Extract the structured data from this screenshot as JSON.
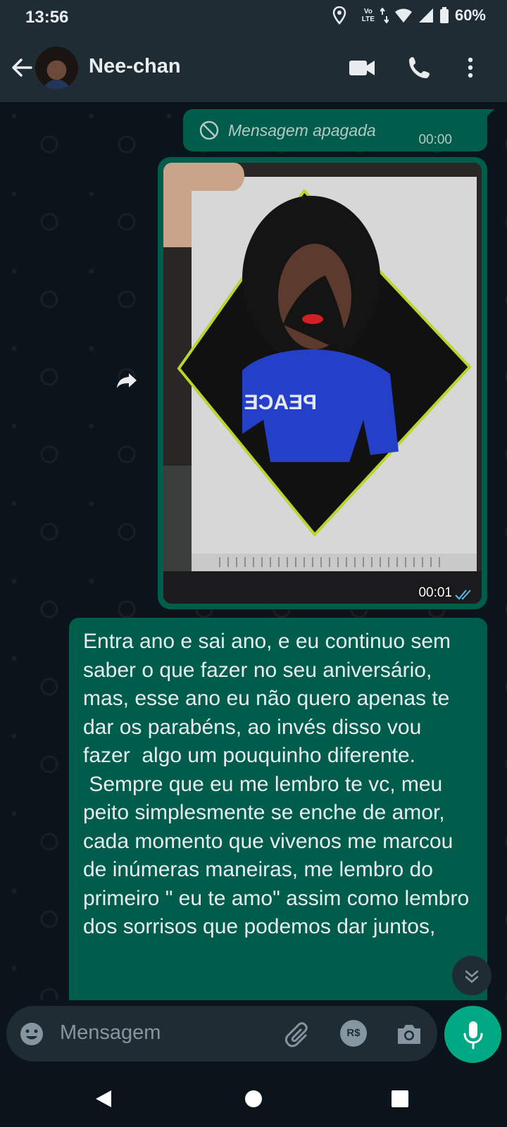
{
  "status_bar": {
    "time": "13:56",
    "network_label_top": "Vo",
    "network_label_bottom": "LTE",
    "battery": "60%",
    "icons": [
      "location-icon",
      "volte-icon",
      "data-arrows-icon",
      "wifi-icon",
      "signal-icon",
      "battery-icon"
    ]
  },
  "header": {
    "contact_name": "Nee-chan",
    "icons": [
      "back-arrow-icon",
      "avatar",
      "video-call-icon",
      "phone-icon",
      "more-vert-icon"
    ]
  },
  "messages": [
    {
      "type": "deleted",
      "text": "Mensagem apagada",
      "time": "00:00",
      "icon": "ban-icon"
    },
    {
      "type": "image",
      "time": "00:01",
      "status": "read",
      "caption_visible_in_photo": "PEACE"
    },
    {
      "type": "text",
      "text": "Entra ano e sai ano, e eu continuo sem saber o que fazer no seu aniversário, mas, esse ano eu não quero apenas te dar os parabéns, ao invés disso vou fazer  algo um pouquinho diferente.\n Sempre que eu me lembro te vc, meu peito simplesmente se enche de amor, cada momento que vivenos me marcou de inúmeras maneiras, me lembro do primeiro \" eu te amo\" assim como lembro dos sorrisos que podemos dar juntos,"
    }
  ],
  "composer": {
    "placeholder": "Mensagem",
    "icons": [
      "emoji-icon",
      "attach-icon",
      "payment-icon",
      "camera-icon",
      "mic-icon"
    ],
    "payment_label": "R$"
  },
  "colors": {
    "header_bg": "#1f2c34",
    "chat_bg": "#0b141a",
    "outgoing_bubble": "#005c4b",
    "accent": "#00a884",
    "read_ticks": "#53bdeb"
  }
}
